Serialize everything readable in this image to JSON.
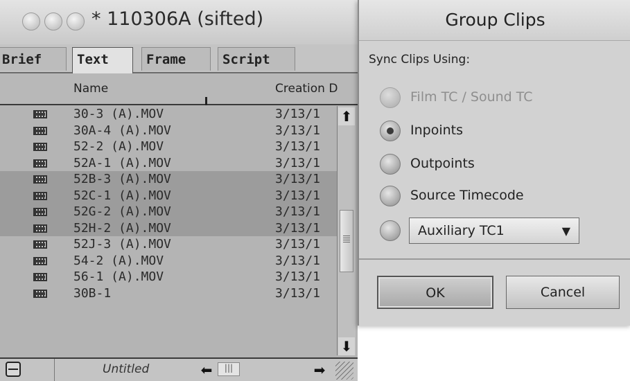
{
  "bin": {
    "title": "* 110306A (sifted)",
    "tabs": [
      "Brief",
      "Text",
      "Frame",
      "Script"
    ],
    "active_tab": "Text",
    "columns": {
      "name": "Name",
      "date": "Creation D"
    },
    "rows": [
      {
        "name": "30-3 (A).MOV",
        "date": "3/13/1",
        "selected": false
      },
      {
        "name": "30A-4 (A).MOV",
        "date": "3/13/1",
        "selected": false
      },
      {
        "name": "52-2 (A).MOV",
        "date": "3/13/1",
        "selected": false
      },
      {
        "name": "52A-1 (A).MOV",
        "date": "3/13/1",
        "selected": false
      },
      {
        "name": "52B-3 (A).MOV",
        "date": "3/13/1",
        "selected": true
      },
      {
        "name": "52C-1 (A).MOV",
        "date": "3/13/1",
        "selected": true
      },
      {
        "name": "52G-2 (A).MOV",
        "date": "3/13/1",
        "selected": true
      },
      {
        "name": "52H-2 (A).MOV",
        "date": "3/13/1",
        "selected": true
      },
      {
        "name": "52J-3 (A).MOV",
        "date": "3/13/1",
        "selected": false
      },
      {
        "name": "54-2 (A).MOV",
        "date": "3/13/1",
        "selected": false
      },
      {
        "name": "56-1 (A).MOV",
        "date": "3/13/1",
        "selected": false
      },
      {
        "name": "30B-1",
        "date": "3/13/1",
        "selected": false
      }
    ],
    "footer": {
      "view_name": "Untitled"
    },
    "icons": {
      "clip": "film-clip-icon",
      "scroll_up": "arrow-up-icon",
      "scroll_down": "arrow-down-icon",
      "scroll_left": "arrow-left-icon",
      "scroll_right": "arrow-right-icon",
      "menu": "bin-menu-icon",
      "resize": "resize-grip-icon"
    }
  },
  "dialog": {
    "title": "Group Clips",
    "section_label": "Sync Clips Using:",
    "options": [
      {
        "label": "Film TC / Sound TC",
        "selected": false,
        "disabled": true
      },
      {
        "label": "Inpoints",
        "selected": true,
        "disabled": false
      },
      {
        "label": "Outpoints",
        "selected": false,
        "disabled": false
      },
      {
        "label": "Source Timecode",
        "selected": false,
        "disabled": false
      }
    ],
    "aux_option": {
      "selected": false,
      "dropdown_value": "Auxiliary TC1"
    },
    "ok_label": "OK",
    "cancel_label": "Cancel"
  }
}
